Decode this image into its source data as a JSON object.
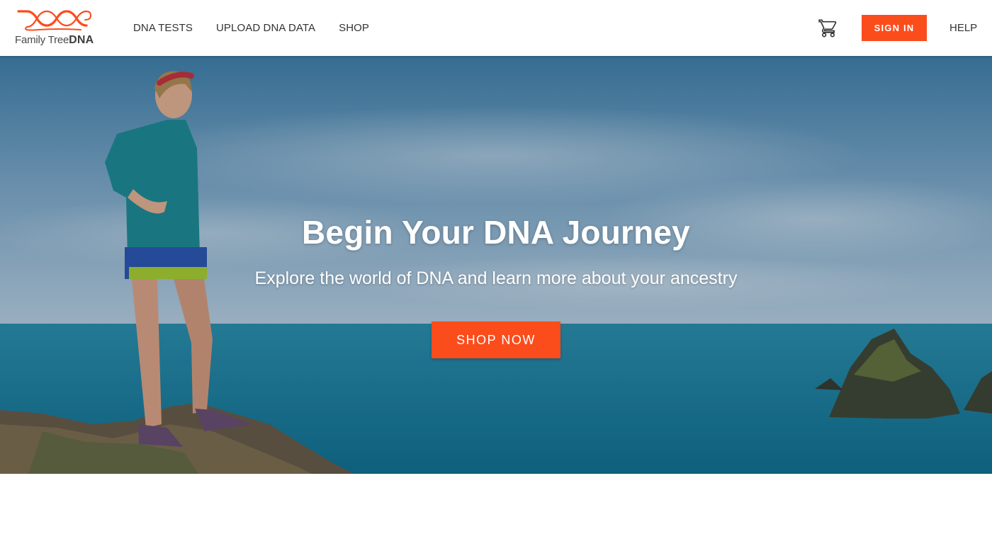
{
  "header": {
    "logo": {
      "name": "Family Tree",
      "name_strong": "DNA"
    },
    "nav": [
      {
        "label": "DNA TESTS"
      },
      {
        "label": "UPLOAD DNA DATA"
      },
      {
        "label": "SHOP"
      }
    ],
    "cart_icon": "shopping-cart-icon",
    "signin_label": "SIGN IN",
    "help_label": "HELP"
  },
  "hero": {
    "title": "Begin Your DNA Journey",
    "subtitle": "Explore the world of DNA and learn more about your ancestry",
    "cta_label": "SHOP NOW"
  },
  "colors": {
    "accent": "#fb4c1c",
    "header_bg": "#ffffff",
    "nav_text": "#333333"
  }
}
